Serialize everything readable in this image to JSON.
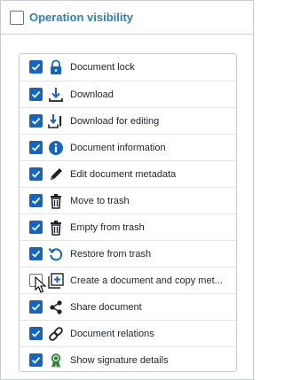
{
  "panel": {
    "title": "Operation visibility",
    "checked": false
  },
  "colors": {
    "accent": "#2f7fb6",
    "checkbox_on": "#1565c0",
    "border": "#c9cdd1"
  },
  "items": [
    {
      "label": "Document lock",
      "checked": true,
      "icon": "lock-icon"
    },
    {
      "label": "Download",
      "checked": true,
      "icon": "download-icon"
    },
    {
      "label": "Download for editing",
      "checked": true,
      "icon": "download-edit-icon"
    },
    {
      "label": "Document information",
      "checked": true,
      "icon": "info-icon"
    },
    {
      "label": "Edit document metadata",
      "checked": true,
      "icon": "pencil-icon"
    },
    {
      "label": "Move to trash",
      "checked": true,
      "icon": "trash-icon"
    },
    {
      "label": "Empty from trash",
      "checked": true,
      "icon": "trash-empty-icon"
    },
    {
      "label": "Restore from trash",
      "checked": true,
      "icon": "restore-icon"
    },
    {
      "label": "Create a document and copy met...",
      "checked": false,
      "icon": "create-copy-icon"
    },
    {
      "label": "Share document",
      "checked": true,
      "icon": "share-icon"
    },
    {
      "label": "Document relations",
      "checked": true,
      "icon": "link-icon"
    },
    {
      "label": "Show signature details",
      "checked": true,
      "icon": "award-icon"
    }
  ]
}
